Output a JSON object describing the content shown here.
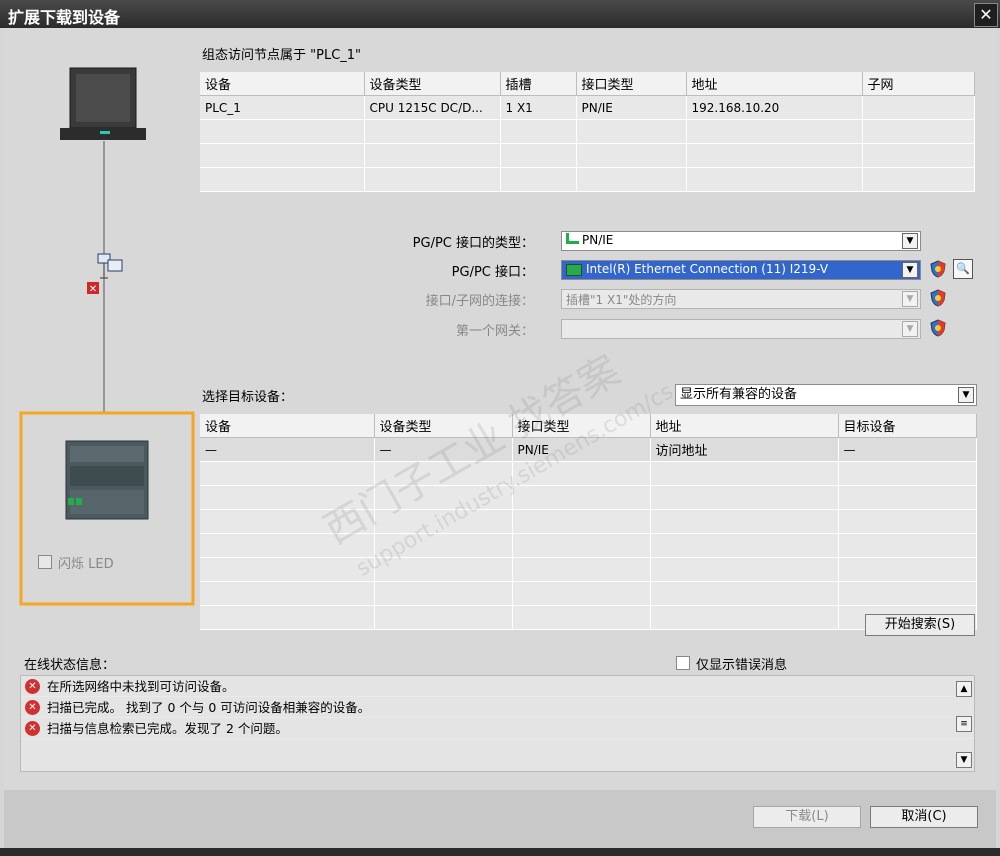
{
  "window": {
    "title": "扩展下载到设备",
    "close_symbol": "✕"
  },
  "configured": {
    "heading": "组态访问节点属于 \"PLC_1\"",
    "columns": [
      "设备",
      "设备类型",
      "插槽",
      "接口类型",
      "地址",
      "子网"
    ],
    "rows": [
      [
        "PLC_1",
        "CPU 1215C DC/D...",
        "1 X1",
        "PN/IE",
        "192.168.10.20",
        ""
      ]
    ]
  },
  "settings": {
    "pgpc_type_label": "PG/PC 接口的类型：",
    "pgpc_type_value": "PN/IE",
    "pgpc_iface_label": "PG/PC 接口：",
    "pgpc_iface_value": "Intel(R) Ethernet Connection (11) I219-V",
    "subnet_conn_label": "接口/子网的连接：",
    "subnet_conn_value": "插槽\"1 X1\"处的方向",
    "gateway_label": "第一个网关：",
    "gateway_value": ""
  },
  "target": {
    "heading": "选择目标设备：",
    "filter_value": "显示所有兼容的设备",
    "columns": [
      "设备",
      "设备类型",
      "接口类型",
      "地址",
      "目标设备"
    ],
    "rows": [
      [
        "—",
        "—",
        "PN/IE",
        "访问地址",
        "—"
      ]
    ]
  },
  "flash_led_label": "闪烁 LED",
  "search_button": "开始搜索(S)",
  "status": {
    "heading": "在线状态信息：",
    "errors_only_label": "仅显示错误消息",
    "messages": [
      "在所选网络中未找到可访问设备。",
      "扫描已完成。 找到了 0 个与 0 可访问设备相兼容的设备。",
      "扫描与信息检索已完成。发现了 2 个问题。"
    ]
  },
  "buttons": {
    "download": "下载(L)",
    "cancel": "取消(C)"
  },
  "watermark": {
    "line1": "西门子工业 找答案",
    "line2": "support.industry.siemens.com/cs"
  },
  "colors": {
    "highlight_border": "#f5a623",
    "selection": "#3366cc",
    "error": "#d03030"
  }
}
